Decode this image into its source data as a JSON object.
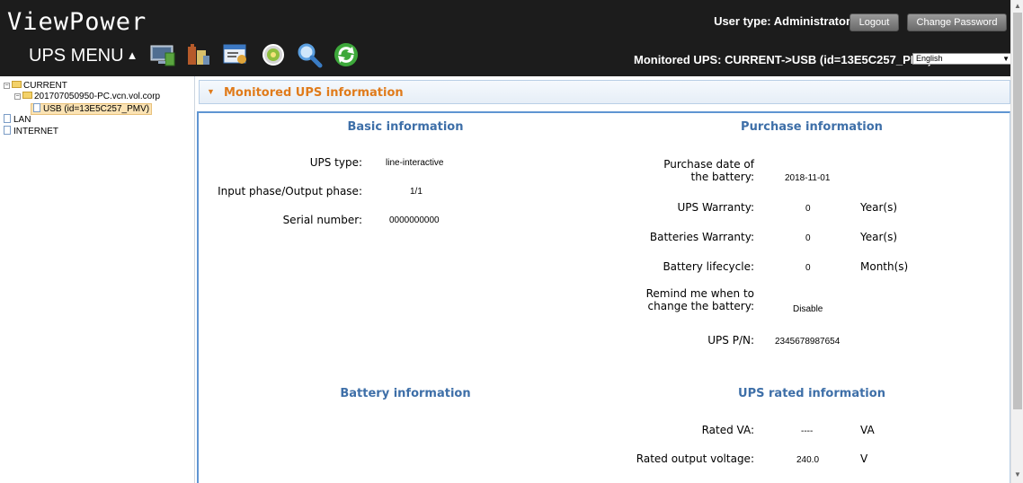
{
  "header": {
    "app_title": "ViewPower",
    "menu_label": "UPS MENU",
    "menu_arrow": "▲",
    "user_type": "User type: Administrator",
    "logout_label": "Logout",
    "change_password_label": "Change Password",
    "monitored_ups": "Monitored UPS: CURRENT->USB (id=13E5C257_PMV)",
    "language": "English",
    "toolbar_icons": [
      "monitor-icon",
      "battery-control-icon",
      "configuration-icon",
      "schedule-icon",
      "search-icon",
      "refresh-icon"
    ]
  },
  "tree": {
    "current": "CURRENT",
    "pc": "201707050950-PC.vcn.vol.corp",
    "usb": "USB (id=13E5C257_PMV)",
    "lan": "LAN",
    "internet": "INTERNET"
  },
  "panel": {
    "title": "Monitored UPS information"
  },
  "basic": {
    "title": "Basic information",
    "ups_type_label": "UPS type:",
    "ups_type_value": "line-interactive",
    "phase_label": "Input phase/Output phase:",
    "phase_value": "1/1",
    "serial_label": "Serial number:",
    "serial_value": "0000000000"
  },
  "purchase": {
    "title": "Purchase information",
    "date_label": "Purchase date of the battery:",
    "date_value": "2018-11-01",
    "warranty_label": "UPS Warranty:",
    "warranty_value": "0",
    "warranty_unit": "Year(s)",
    "batt_warranty_label": "Batteries Warranty:",
    "batt_warranty_value": "0",
    "batt_warranty_unit": "Year(s)",
    "lifecycle_label": "Battery lifecycle:",
    "lifecycle_value": "0",
    "lifecycle_unit": "Month(s)",
    "remind_label": "Remind me when to change the battery:",
    "remind_value": "Disable",
    "pn_label": "UPS P/N:",
    "pn_value": "2345678987654"
  },
  "battery": {
    "title": "Battery information"
  },
  "rated": {
    "title": "UPS rated information",
    "va_label": "Rated VA:",
    "va_value": "----",
    "va_unit": "VA",
    "voltage_label": "Rated output voltage:",
    "voltage_value": "240.0",
    "voltage_unit": "V"
  },
  "colors": {
    "header_bg": "#1c1c1c",
    "accent_orange": "#e07b1b",
    "section_title_blue": "#3e6fa8",
    "content_border_blue": "#5f95d2"
  }
}
